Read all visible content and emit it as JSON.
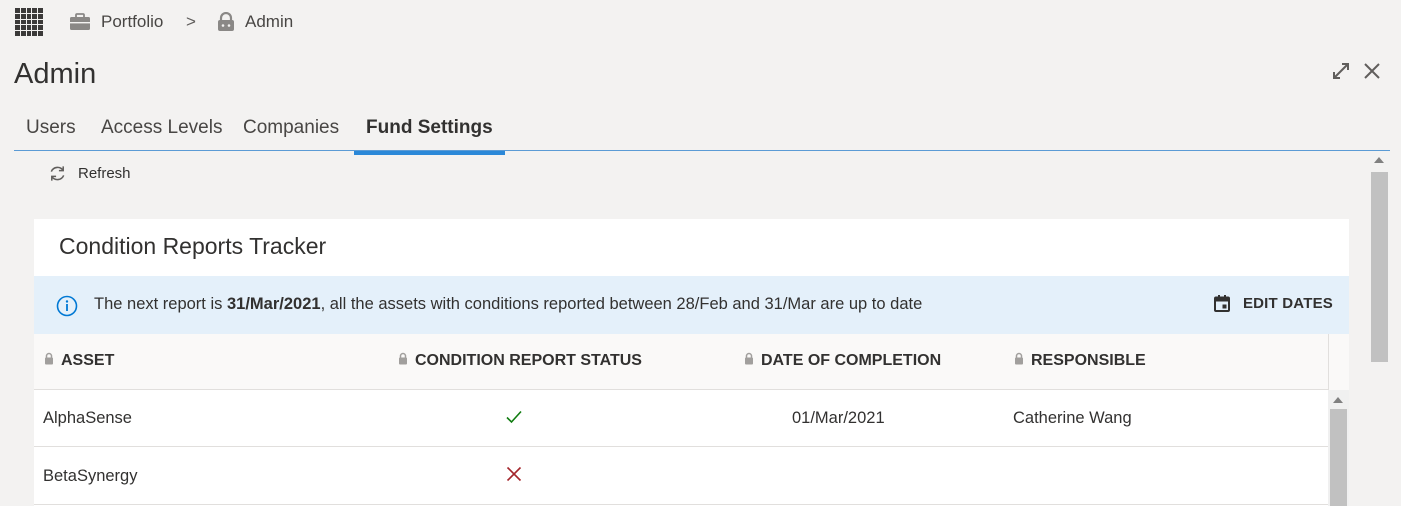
{
  "breadcrumb": {
    "items": [
      {
        "label": "Portfolio",
        "icon": "briefcase-icon"
      },
      {
        "label": "Admin",
        "icon": "lock-icon"
      }
    ],
    "separator": ">"
  },
  "page": {
    "title": "Admin"
  },
  "tabs": [
    {
      "label": "Users",
      "active": false
    },
    {
      "label": "Access Levels",
      "active": false
    },
    {
      "label": "Companies",
      "active": false
    },
    {
      "label": "Fund Settings",
      "active": true
    }
  ],
  "toolbar": {
    "refresh_label": "Refresh"
  },
  "tracker": {
    "title": "Condition Reports Tracker",
    "info": {
      "prefix": "The next report is ",
      "date": "31/Mar/2021",
      "suffix": ", all the assets with conditions reported between 28/Feb and 31/Mar are up to date"
    },
    "edit_dates_label": "EDIT DATES",
    "columns": [
      "ASSET",
      "CONDITION REPORT STATUS",
      "DATE OF COMPLETION",
      "RESPONSIBLE"
    ],
    "rows": [
      {
        "asset": "AlphaSense",
        "status": "complete",
        "date": "01/Mar/2021",
        "responsible": "Catherine Wang"
      },
      {
        "asset": "BetaSynergy",
        "status": "incomplete",
        "date": "",
        "responsible": ""
      }
    ]
  },
  "colors": {
    "accent": "#2b88d8",
    "info_bg": "#e4f0fa",
    "check": "#107c10",
    "cross": "#a4262c"
  }
}
